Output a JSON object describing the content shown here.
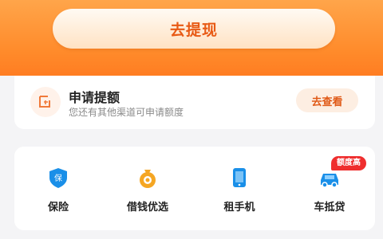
{
  "withdraw": {
    "label": "去提现"
  },
  "apply": {
    "title": "申请提额",
    "subtitle": "您还有其他渠道可申请额度",
    "button": "去查看",
    "icon": "document-icon"
  },
  "services": {
    "badge": "额度高",
    "items": [
      {
        "label": "保险",
        "icon": "shield-icon"
      },
      {
        "label": "借钱优选",
        "icon": "money-bag-icon"
      },
      {
        "label": "租手机",
        "icon": "phone-icon"
      },
      {
        "label": "车抵贷",
        "icon": "car-icon"
      }
    ]
  },
  "colors": {
    "accent_orange": "#ff8a2a",
    "primary_blue": "#1a8fe8",
    "badge_red": "#ef2e2e"
  }
}
